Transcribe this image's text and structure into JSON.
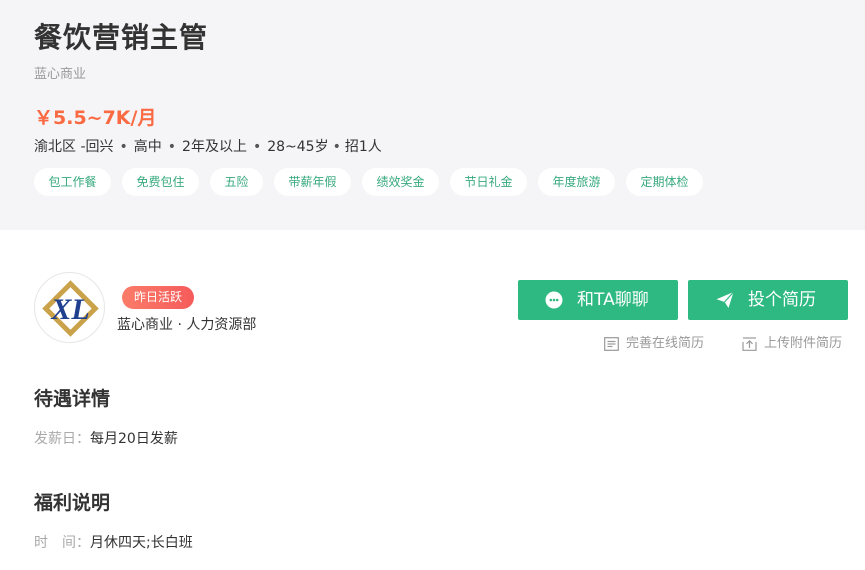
{
  "job": {
    "title": "餐饮营销主管",
    "company": "蓝心商业",
    "salary": "￥5.5~7K/月",
    "meta": [
      "渝北区 -回兴",
      "高中",
      "2年及以上",
      "28~45岁",
      "招1人"
    ],
    "tags": [
      "包工作餐",
      "免费包住",
      "五险",
      "带薪年假",
      "绩效奖金",
      "节日礼金",
      "年度旅游",
      "定期体检"
    ]
  },
  "employer": {
    "active_badge": "昨日活跃",
    "name": "蓝心商业 · 人力资源部",
    "logo_text": "XL"
  },
  "actions": {
    "chat_label": "和TA聊聊",
    "apply_label": "投个简历",
    "online_resume_label": "完善在线简历",
    "upload_resume_label": "上传附件简历"
  },
  "sections": {
    "pay": {
      "title": "待遇详情",
      "payday_label": "发薪日：",
      "payday_value": "每月20日发薪"
    },
    "benefits": {
      "title": "福利说明",
      "time_label": "时　间：",
      "time_value": "月休四天;长白班"
    }
  },
  "colors": {
    "accent": "#2eb982",
    "salary": "#fa6a43",
    "tag_text": "#37a97e",
    "header_bg": "#f5f5f7",
    "badge": "#f55b5b"
  },
  "icons": [
    "chat-bubble-icon",
    "paper-plane-icon",
    "document-icon",
    "upload-icon"
  ]
}
